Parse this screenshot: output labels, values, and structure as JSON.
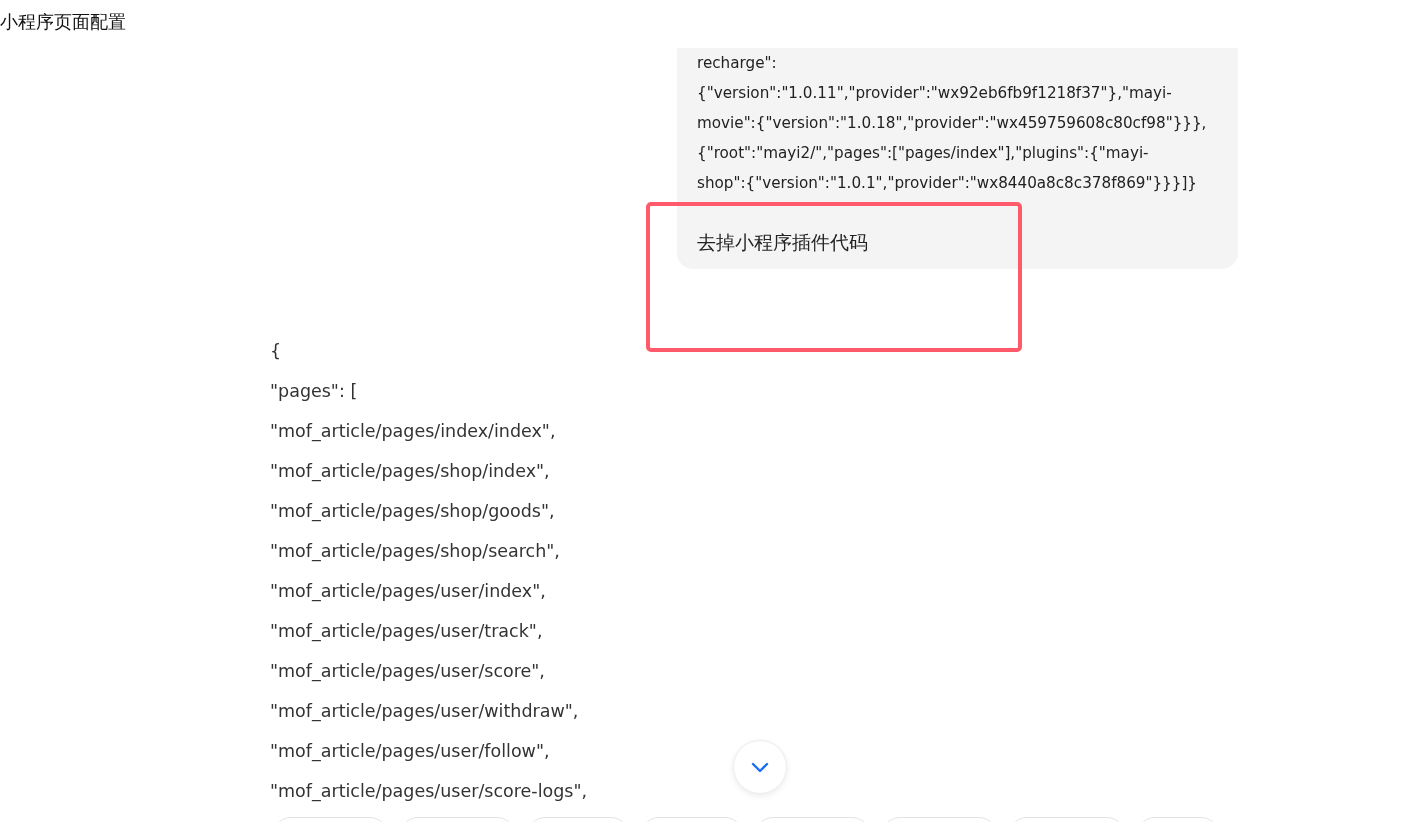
{
  "header": {
    "title": "小程序页面配置"
  },
  "user_message": {
    "code_lines": [
      "recharge\":",
      "{\"version\":\"1.0.11\",\"provider\":\"wx92eb6fb9f1218f37\"},\"mayi-",
      "movie\":{\"version\":\"1.0.18\",\"provider\":\"wx459759608c80cf98\"}}},",
      "{\"root\":\"mayi2/\",\"pages\":[\"pages/index\"],\"plugins\":{\"mayi-",
      "shop\":{\"version\":\"1.0.1\",\"provider\":\"wx8440a8c8c378f869\"}}}]}"
    ],
    "text": "去掉小程序插件代码"
  },
  "annotation": {
    "kind": "rectangle"
  },
  "reply": {
    "code_lines": [
      "{",
      "\"pages\": [",
      "\"mof_article/pages/index/index\",",
      "\"mof_article/pages/shop/index\",",
      "\"mof_article/pages/shop/goods\",",
      "\"mof_article/pages/shop/search\",",
      "\"mof_article/pages/user/index\",",
      "\"mof_article/pages/user/track\",",
      "\"mof_article/pages/user/score\",",
      "\"mof_article/pages/user/withdraw\",",
      "\"mof_article/pages/user/follow\",",
      "\"mof_article/pages/user/score-logs\","
    ]
  },
  "scroll_button": {
    "kind": "scroll-down"
  },
  "suggestion_chips": [
    {
      "kind": "chip"
    },
    {
      "kind": "chip"
    },
    {
      "kind": "chip"
    },
    {
      "kind": "chip"
    },
    {
      "kind": "chip"
    },
    {
      "kind": "chip"
    },
    {
      "kind": "chip"
    },
    {
      "kind": "chip"
    }
  ]
}
